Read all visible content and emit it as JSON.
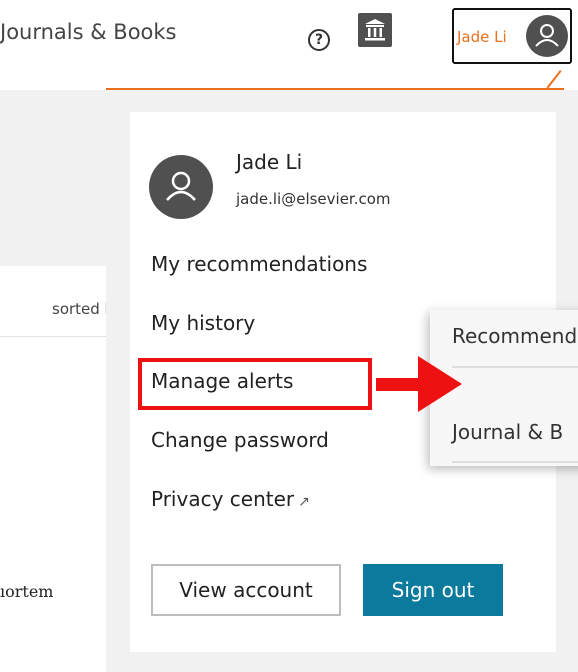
{
  "header": {
    "nav_link": "Journals & Books",
    "help_icon": "help-circle-icon",
    "help_glyph": "?",
    "institution_icon": "institution-icon",
    "user_button_name": "Jade Li",
    "user_icon": "person-icon"
  },
  "background": {
    "sorted_text": "sorted b",
    "snippet_text": "ıortem"
  },
  "account": {
    "name": "Jade Li",
    "email": "jade.li@elsevier.com"
  },
  "menu": {
    "items": [
      {
        "label": "My recommendations"
      },
      {
        "label": "My history"
      },
      {
        "label": "Manage alerts"
      },
      {
        "label": "Change password"
      },
      {
        "label": "Privacy center"
      }
    ],
    "external_glyph": "↗"
  },
  "buttons": {
    "view_account": "View account",
    "sign_out": "Sign out"
  },
  "submenu": {
    "items": [
      {
        "label": "Recommend"
      },
      {
        "label": "Journal & B"
      }
    ]
  },
  "colors": {
    "accent_orange": "#e9711c",
    "primary_blue": "#0b7a9c",
    "highlight_red": "#ee1111",
    "icon_grey": "#505050"
  }
}
